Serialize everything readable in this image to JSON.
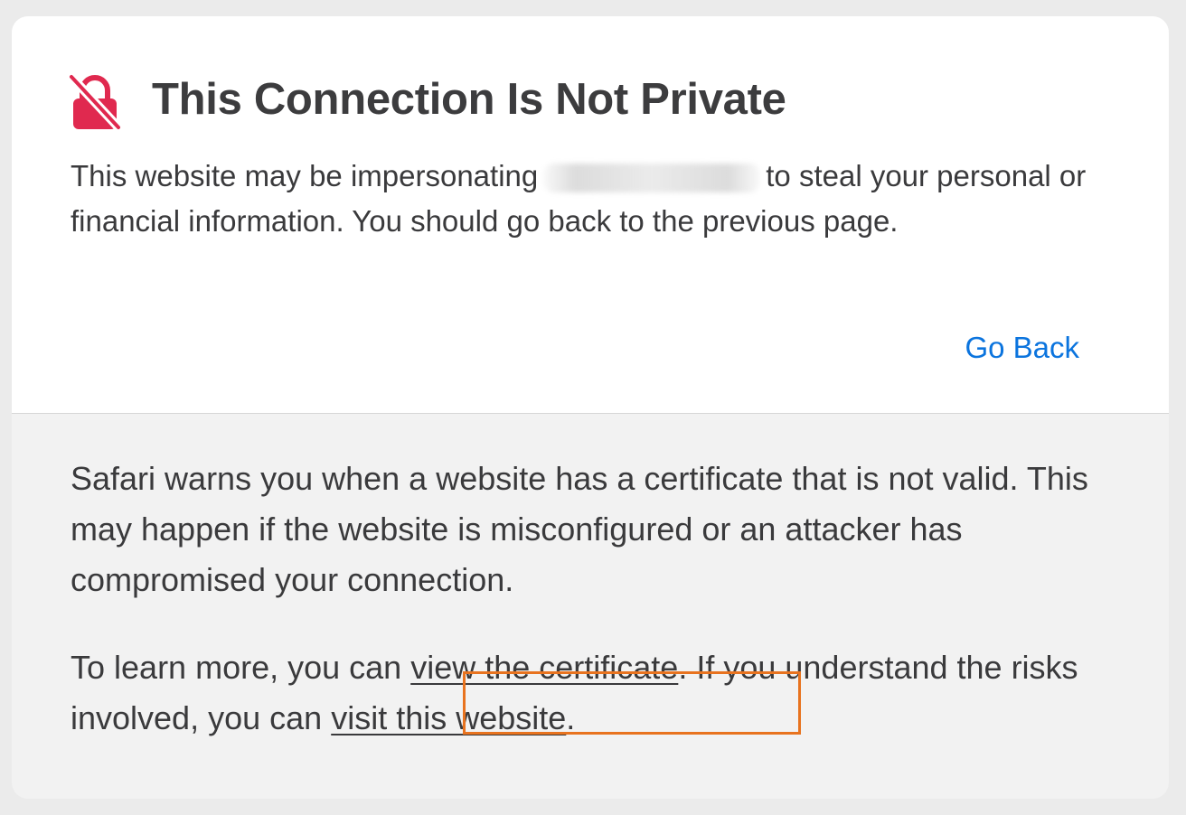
{
  "warning": {
    "title": "This Connection Is Not Private",
    "description_before": "This website may be impersonating",
    "description_after": "to steal your personal or financial information. You should go back to the previous page.",
    "go_back_label": "Go Back"
  },
  "details": {
    "paragraph1": "Safari warns you when a website has a certificate that is not valid. This may happen if the website is misconfigured or an attacker has compromised your connection.",
    "paragraph2_prefix": "To learn more, you can",
    "view_certificate_label": "view the certificate",
    "paragraph2_middle": ". If you understand the risks involved, you can",
    "visit_website_label": "visit this website",
    "paragraph2_suffix": "."
  },
  "colors": {
    "lock_icon": "#e0294f",
    "link_blue": "#0b74de",
    "highlight_orange": "#e8731f"
  },
  "icons": {
    "warning_icon": "lock-slash-icon"
  }
}
